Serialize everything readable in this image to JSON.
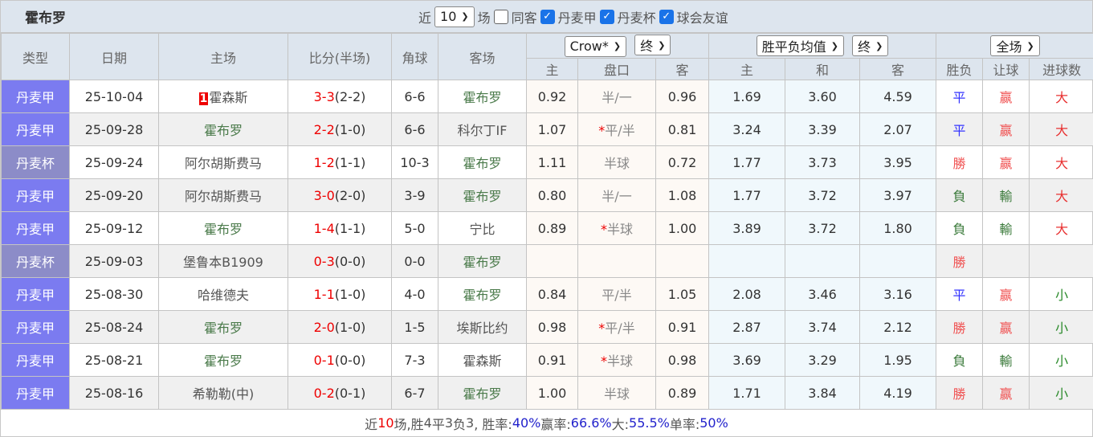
{
  "title": "霍布罗",
  "filters": {
    "recent_label": "近",
    "recent_value": "10",
    "games_label": "场",
    "same_away_label": "同客",
    "same_away_checked": false,
    "leagues": [
      {
        "label": "丹麦甲",
        "checked": true
      },
      {
        "label": "丹麦杯",
        "checked": true
      },
      {
        "label": "球会友谊",
        "checked": true
      }
    ]
  },
  "headers": {
    "type": "类型",
    "date": "日期",
    "home": "主场",
    "score": "比分(半场)",
    "corner": "角球",
    "away": "客场",
    "company": "Crow*",
    "company_stage": "终",
    "odds_type": "胜平负均值",
    "odds_stage": "终",
    "period": "全场",
    "ah_home": "主",
    "ah_line": "盘口",
    "ah_away": "客",
    "eu_home": "主",
    "eu_draw": "和",
    "eu_away": "客",
    "result": "胜负",
    "handicap": "让球",
    "goals": "进球数"
  },
  "colors": {
    "league_div1": "#7b7bf0",
    "league_cup": "#8c8cc8",
    "highlight_team": "#4a7a4a",
    "score_red": "#ee0000"
  },
  "rows": [
    {
      "type": "丹麦甲",
      "date": "25-10-04",
      "rank": "1",
      "home": "霍森斯",
      "home_hl": false,
      "ft": "3-3",
      "ht": "(2-2)",
      "corner": "6-6",
      "away": "霍布罗",
      "away_hl": true,
      "ah_h": "0.92",
      "star": "",
      "ah_line": "半/一",
      "ah_a": "0.96",
      "eu_h": "1.69",
      "eu_d": "3.60",
      "eu_a": "4.59",
      "res": "平",
      "hc": "赢",
      "goals": "大"
    },
    {
      "type": "丹麦甲",
      "date": "25-09-28",
      "rank": "",
      "home": "霍布罗",
      "home_hl": true,
      "ft": "2-2",
      "ht": "(1-0)",
      "corner": "6-6",
      "away": "科尔丁IF",
      "away_hl": false,
      "ah_h": "1.07",
      "star": "*",
      "ah_line": "平/半",
      "ah_a": "0.81",
      "eu_h": "3.24",
      "eu_d": "3.39",
      "eu_a": "2.07",
      "res": "平",
      "hc": "赢",
      "goals": "大"
    },
    {
      "type": "丹麦杯",
      "date": "25-09-24",
      "rank": "",
      "home": "阿尔胡斯费马",
      "home_hl": false,
      "ft": "1-2",
      "ht": "(1-1)",
      "corner": "10-3",
      "away": "霍布罗",
      "away_hl": true,
      "ah_h": "1.11",
      "star": "",
      "ah_line": "半球",
      "ah_a": "0.72",
      "eu_h": "1.77",
      "eu_d": "3.73",
      "eu_a": "3.95",
      "res": "勝",
      "hc": "赢",
      "goals": "大"
    },
    {
      "type": "丹麦甲",
      "date": "25-09-20",
      "rank": "",
      "home": "阿尔胡斯费马",
      "home_hl": false,
      "ft": "3-0",
      "ht": "(2-0)",
      "corner": "3-9",
      "away": "霍布罗",
      "away_hl": true,
      "ah_h": "0.80",
      "star": "",
      "ah_line": "半/一",
      "ah_a": "1.08",
      "eu_h": "1.77",
      "eu_d": "3.72",
      "eu_a": "3.97",
      "res": "負",
      "hc": "輸",
      "goals": "大"
    },
    {
      "type": "丹麦甲",
      "date": "25-09-12",
      "rank": "",
      "home": "霍布罗",
      "home_hl": true,
      "ft": "1-4",
      "ht": "(1-1)",
      "corner": "5-0",
      "away": "宁比",
      "away_hl": false,
      "ah_h": "0.89",
      "star": "*",
      "ah_line": "半球",
      "ah_a": "1.00",
      "eu_h": "3.89",
      "eu_d": "3.72",
      "eu_a": "1.80",
      "res": "負",
      "hc": "輸",
      "goals": "大"
    },
    {
      "type": "丹麦杯",
      "date": "25-09-03",
      "rank": "",
      "home": "堡鲁本B1909",
      "home_hl": false,
      "ft": "0-3",
      "ht": "(0-0)",
      "corner": "0-0",
      "away": "霍布罗",
      "away_hl": true,
      "ah_h": "",
      "star": "",
      "ah_line": "",
      "ah_a": "",
      "eu_h": "",
      "eu_d": "",
      "eu_a": "",
      "res": "勝",
      "hc": "",
      "goals": ""
    },
    {
      "type": "丹麦甲",
      "date": "25-08-30",
      "rank": "",
      "home": "哈维德夫",
      "home_hl": false,
      "ft": "1-1",
      "ht": "(1-0)",
      "corner": "4-0",
      "away": "霍布罗",
      "away_hl": true,
      "ah_h": "0.84",
      "star": "",
      "ah_line": "平/半",
      "ah_a": "1.05",
      "eu_h": "2.08",
      "eu_d": "3.46",
      "eu_a": "3.16",
      "res": "平",
      "hc": "赢",
      "goals": "小"
    },
    {
      "type": "丹麦甲",
      "date": "25-08-24",
      "rank": "",
      "home": "霍布罗",
      "home_hl": true,
      "ft": "2-0",
      "ht": "(1-0)",
      "corner": "1-5",
      "away": "埃斯比约",
      "away_hl": false,
      "ah_h": "0.98",
      "star": "*",
      "ah_line": "平/半",
      "ah_a": "0.91",
      "eu_h": "2.87",
      "eu_d": "3.74",
      "eu_a": "2.12",
      "res": "勝",
      "hc": "赢",
      "goals": "小"
    },
    {
      "type": "丹麦甲",
      "date": "25-08-21",
      "rank": "",
      "home": "霍布罗",
      "home_hl": true,
      "ft": "0-1",
      "ht": "(0-0)",
      "corner": "7-3",
      "away": "霍森斯",
      "away_hl": false,
      "ah_h": "0.91",
      "star": "*",
      "ah_line": "半球",
      "ah_a": "0.98",
      "eu_h": "3.69",
      "eu_d": "3.29",
      "eu_a": "1.95",
      "res": "負",
      "hc": "輸",
      "goals": "小"
    },
    {
      "type": "丹麦甲",
      "date": "25-08-16",
      "rank": "",
      "home": "希勒勒(中)",
      "home_hl": false,
      "ft": "0-2",
      "ht": "(0-1)",
      "corner": "6-7",
      "away": "霍布罗",
      "away_hl": true,
      "ah_h": "1.00",
      "star": "",
      "ah_line": "半球",
      "ah_a": "0.89",
      "eu_h": "1.71",
      "eu_d": "3.84",
      "eu_a": "4.19",
      "res": "勝",
      "hc": "赢",
      "goals": "小"
    }
  ],
  "summary": {
    "p1": "近",
    "games": "10",
    "p2": "场,胜",
    "w": "4",
    "p3": "平",
    "d": "3",
    "p4": "负",
    "l": "3",
    "p5": ", 胜率:",
    "win_rate": "40%",
    "p6": " 赢率:",
    "hc_rate": "66.6%",
    "p7": " 大:",
    "big_rate": "55.5%",
    "p8": " 单率:",
    "odd_rate": "50%"
  }
}
